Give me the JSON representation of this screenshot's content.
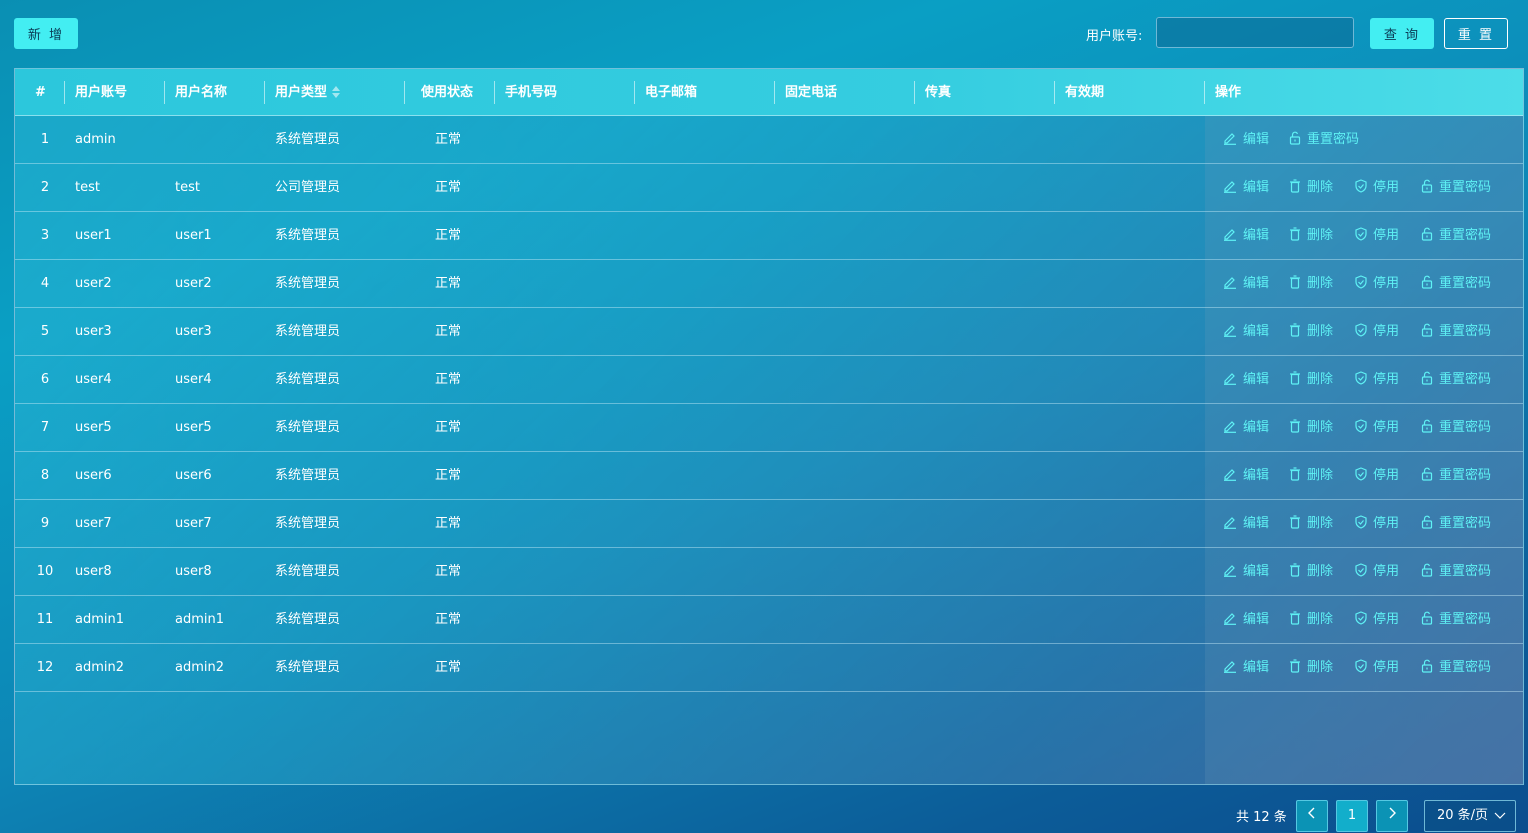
{
  "toolbar": {
    "add_label": "新 增",
    "search_label": "用户账号:",
    "search_value": "",
    "query_label": "查 询",
    "reset_label": "重 置"
  },
  "table": {
    "columns": [
      "#",
      "用户账号",
      "用户名称",
      "用户类型",
      "使用状态",
      "手机号码",
      "电子邮箱",
      "固定电话",
      "传真",
      "有效期",
      "操作"
    ],
    "rows": [
      {
        "no": "1",
        "account": "admin",
        "name": "",
        "type": "系统管理员",
        "status": "正常",
        "ops": [
          "编辑",
          "重置密码"
        ]
      },
      {
        "no": "2",
        "account": "test",
        "name": "test",
        "type": "公司管理员",
        "status": "正常",
        "ops": [
          "编辑",
          "删除",
          "停用",
          "重置密码"
        ]
      },
      {
        "no": "3",
        "account": "user1",
        "name": "user1",
        "type": "系统管理员",
        "status": "正常",
        "ops": [
          "编辑",
          "删除",
          "停用",
          "重置密码"
        ]
      },
      {
        "no": "4",
        "account": "user2",
        "name": "user2",
        "type": "系统管理员",
        "status": "正常",
        "ops": [
          "编辑",
          "删除",
          "停用",
          "重置密码"
        ]
      },
      {
        "no": "5",
        "account": "user3",
        "name": "user3",
        "type": "系统管理员",
        "status": "正常",
        "ops": [
          "编辑",
          "删除",
          "停用",
          "重置密码"
        ]
      },
      {
        "no": "6",
        "account": "user4",
        "name": "user4",
        "type": "系统管理员",
        "status": "正常",
        "ops": [
          "编辑",
          "删除",
          "停用",
          "重置密码"
        ]
      },
      {
        "no": "7",
        "account": "user5",
        "name": "user5",
        "type": "系统管理员",
        "status": "正常",
        "ops": [
          "编辑",
          "删除",
          "停用",
          "重置密码"
        ]
      },
      {
        "no": "8",
        "account": "user6",
        "name": "user6",
        "type": "系统管理员",
        "status": "正常",
        "ops": [
          "编辑",
          "删除",
          "停用",
          "重置密码"
        ]
      },
      {
        "no": "9",
        "account": "user7",
        "name": "user7",
        "type": "系统管理员",
        "status": "正常",
        "ops": [
          "编辑",
          "删除",
          "停用",
          "重置密码"
        ]
      },
      {
        "no": "10",
        "account": "user8",
        "name": "user8",
        "type": "系统管理员",
        "status": "正常",
        "ops": [
          "编辑",
          "删除",
          "停用",
          "重置密码"
        ]
      },
      {
        "no": "11",
        "account": "admin1",
        "name": "admin1",
        "type": "系统管理员",
        "status": "正常",
        "ops": [
          "编辑",
          "删除",
          "停用",
          "重置密码"
        ]
      },
      {
        "no": "12",
        "account": "admin2",
        "name": "admin2",
        "type": "系统管理员",
        "status": "正常",
        "ops": [
          "编辑",
          "删除",
          "停用",
          "重置密码"
        ]
      }
    ]
  },
  "pagination": {
    "total_label": "共 12 条",
    "prev": "<",
    "current_page": "1",
    "next": ">",
    "page_size": "20 条/页"
  },
  "icons": {
    "edit": "edit-icon",
    "delete": "trash-icon",
    "disable": "shield-check-icon",
    "reset_password": "unlock-icon",
    "sort": "sort-icon",
    "dropdown": "chevron-down-icon"
  },
  "colors": {
    "accent": "#43eef2",
    "link": "#5ff2f5",
    "header": "#35cde0"
  }
}
